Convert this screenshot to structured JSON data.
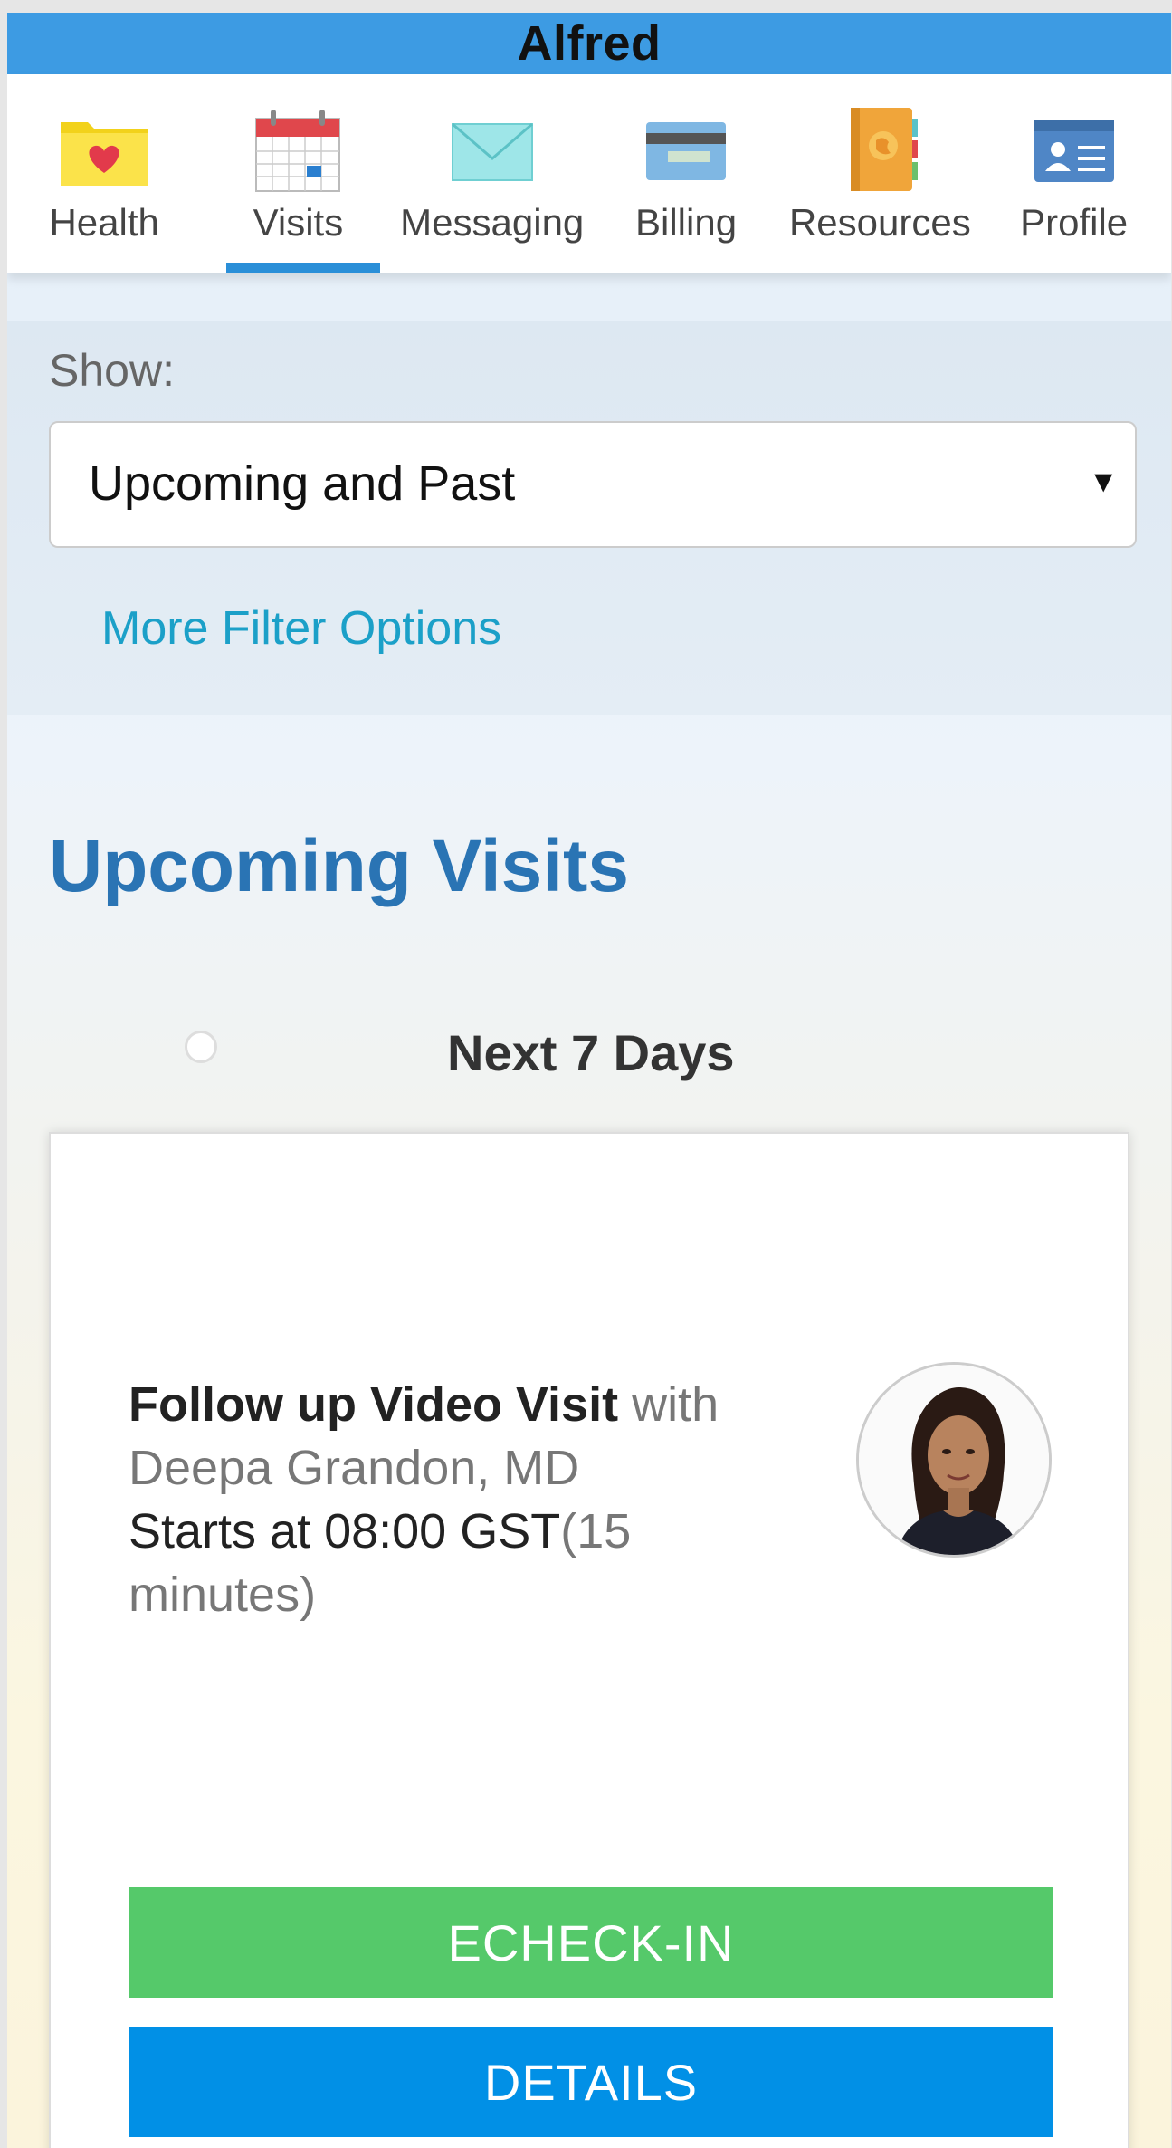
{
  "app": {
    "title": "Alfred"
  },
  "nav": {
    "items": [
      {
        "label": "Health",
        "icon": "folder-heart-icon"
      },
      {
        "label": "Visits",
        "icon": "calendar-icon",
        "active": true
      },
      {
        "label": "Messaging",
        "icon": "envelope-icon"
      },
      {
        "label": "Billing",
        "icon": "credit-card-icon"
      },
      {
        "label": "Resources",
        "icon": "book-globe-icon"
      },
      {
        "label": "Profile",
        "icon": "id-card-icon"
      }
    ]
  },
  "filter": {
    "show_label": "Show:",
    "selected": "Upcoming and Past",
    "caret": "▼",
    "more_options": "More Filter Options"
  },
  "upcoming": {
    "title": "Upcoming Visits",
    "range_label": "Next 7 Days",
    "visit": {
      "type": "Follow up Video Visit",
      "with": " with",
      "provider": "Deepa Grandon, MD",
      "starts": "Starts at 08:00 GST",
      "duration": "(15 minutes)",
      "checkin_label": "ECHECK-IN",
      "details_label": "DETAILS"
    }
  },
  "colors": {
    "header": "#3d9be3",
    "accent": "#2a8fd8",
    "link": "#1ba0c8",
    "section_title": "#2a74b4",
    "checkin": "#55c96a",
    "details": "#0190e6"
  }
}
